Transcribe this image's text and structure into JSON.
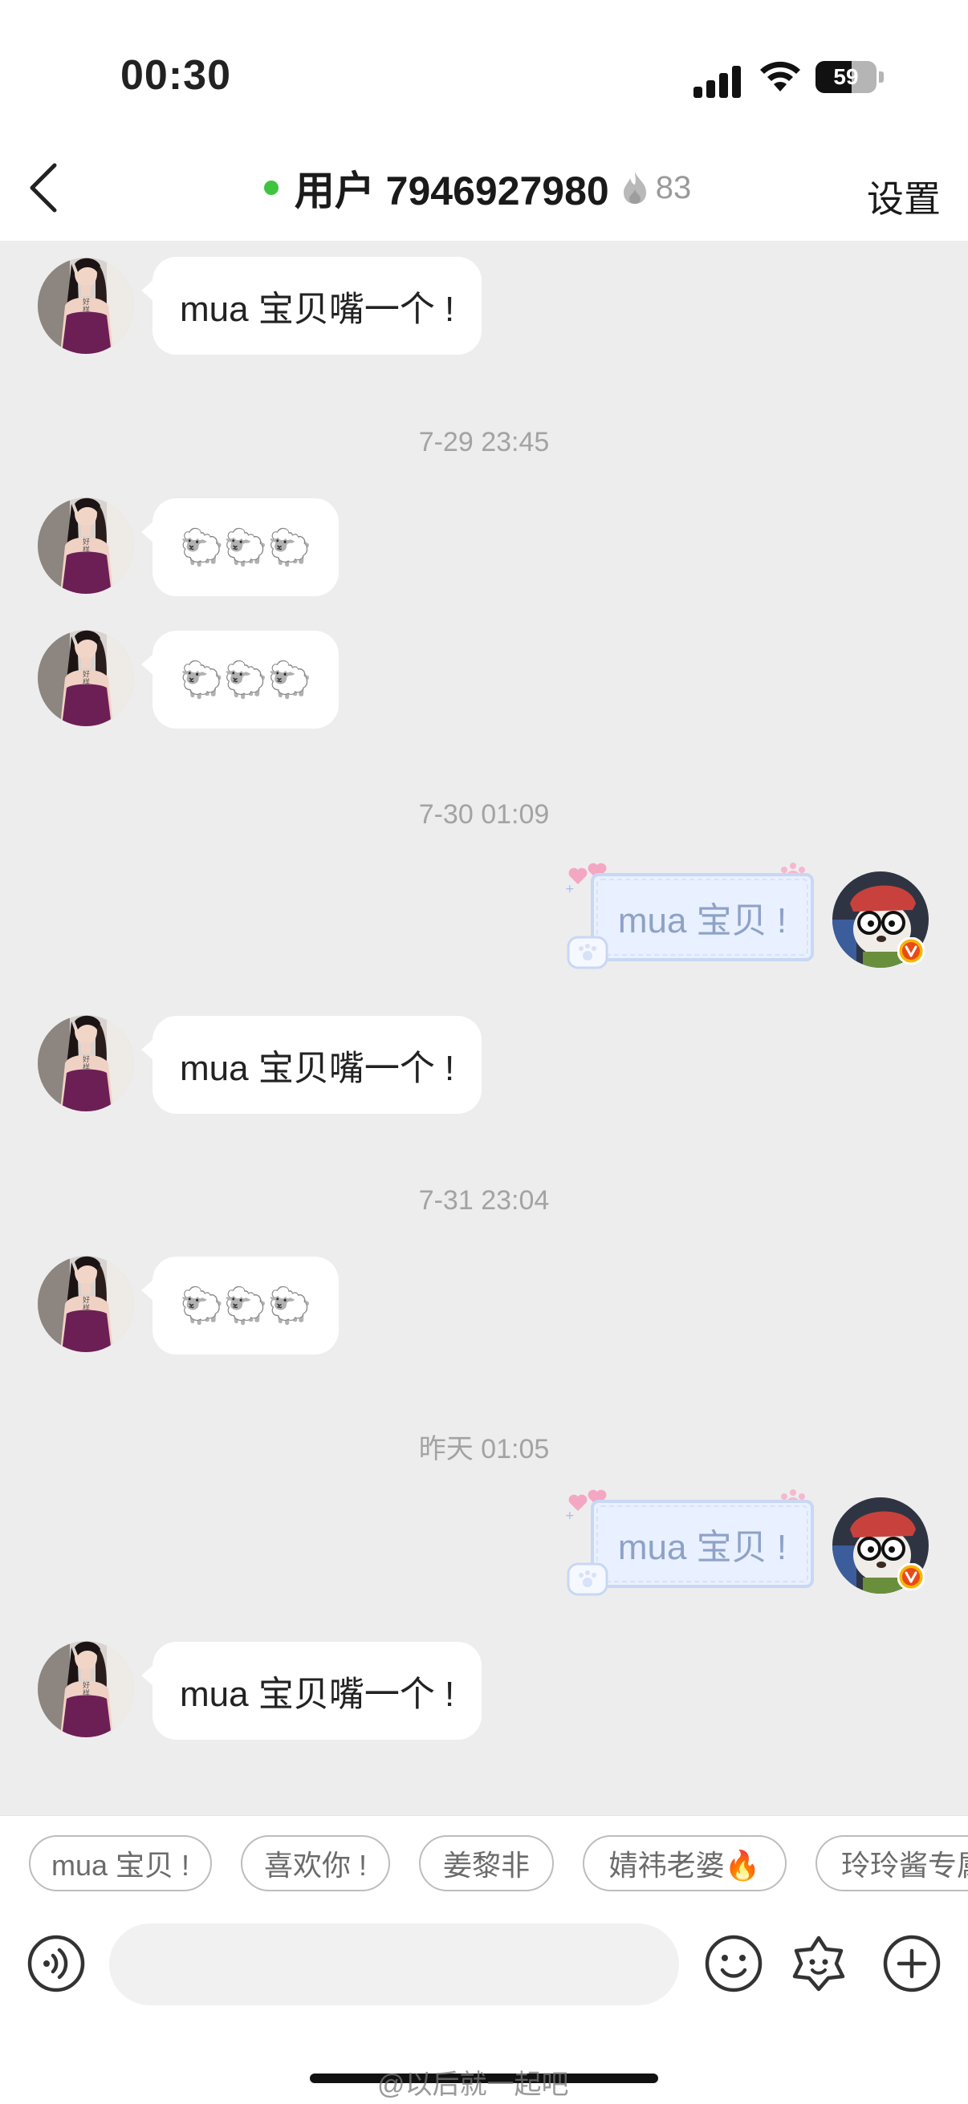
{
  "status_bar": {
    "time": "00:30",
    "battery": "59",
    "battery_level": 0.59
  },
  "header": {
    "title": "用户 7946927980",
    "heat": "83",
    "settings_label": "设置",
    "back_icon": "chevron-left-icon"
  },
  "messages": [
    {
      "side": "left",
      "text": "mua 宝贝嘴一个 !"
    },
    {
      "timestamp": "7-29 23:45"
    },
    {
      "side": "left",
      "text": "🐑🐑🐑"
    },
    {
      "side": "left",
      "text": "🐑🐑🐑"
    },
    {
      "timestamp": "7-30 01:09"
    },
    {
      "side": "right",
      "text": "mua 宝贝 !"
    },
    {
      "side": "left",
      "text": "mua 宝贝嘴一个 !"
    },
    {
      "timestamp": "7-31 23:04"
    },
    {
      "side": "left",
      "text": "🐑🐑🐑"
    },
    {
      "timestamp": "昨天 01:05"
    },
    {
      "side": "right",
      "text": "mua 宝贝 !"
    },
    {
      "side": "left",
      "text": "mua 宝贝嘴一个 !"
    }
  ],
  "quick_replies": [
    "mua 宝贝 !",
    "喜欢你 !",
    "姜黎非",
    "婧祎老婆🔥",
    "玲玲酱专属"
  ],
  "input": {
    "placeholder": ""
  },
  "toolbar_icons": [
    "voice-icon",
    "emoji-icon",
    "sticker-icon",
    "plus-icon"
  ],
  "watermark": "@以后就一起吧",
  "colors": {
    "online": "#3ec43e",
    "bubble_right_bg": "#e9f0ff",
    "chat_bg": "#ededed"
  }
}
